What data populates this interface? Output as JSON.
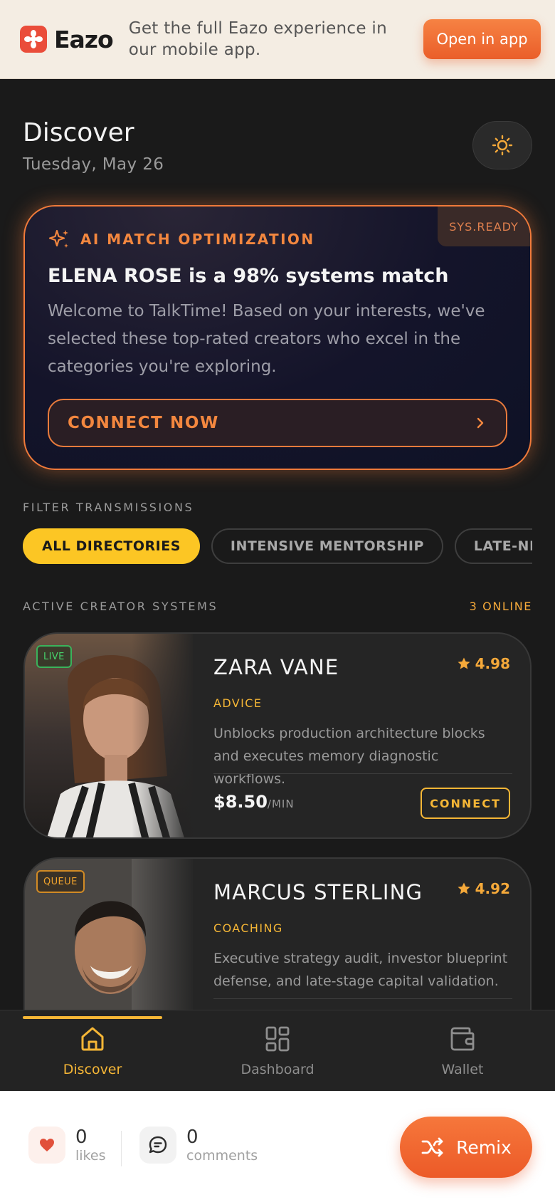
{
  "banner": {
    "brand": "Eazo",
    "text": "Get the full Eazo experience in our mobile app.",
    "open_label": "Open in app"
  },
  "header": {
    "title": "Discover",
    "date": "Tuesday, May 26"
  },
  "ai_card": {
    "badge": "SYS.READY",
    "kicker": "AI MATCH OPTIMIZATION",
    "title": "ELENA ROSE is a 98% systems match",
    "body": "Welcome to TalkTime! Based on your interests, we've selected these top-rated creators who excel in the categories you're exploring.",
    "cta": "CONNECT NOW"
  },
  "filters": {
    "label": "FILTER TRANSMISSIONS",
    "chips": [
      "ALL DIRECTORIES",
      "INTENSIVE MENTORSHIP",
      "LATE-NIGHT"
    ]
  },
  "creators_section": {
    "label": "ACTIVE CREATOR SYSTEMS",
    "online": "3 ONLINE"
  },
  "creators": [
    {
      "status": "LIVE",
      "name": "ZARA VANE",
      "rating": "4.98",
      "category": "ADVICE",
      "description": "Unblocks production architecture blocks and executes memory diagnostic workflows.",
      "price": "$8.50",
      "unit": "/MIN",
      "cta": "CONNECT"
    },
    {
      "status": "QUEUE",
      "name": "MARCUS STERLING",
      "rating": "4.92",
      "category": "COACHING",
      "description": "Executive strategy audit, investor blueprint defense, and late-stage capital validation."
    }
  ],
  "nav": {
    "items": [
      {
        "label": "Discover",
        "icon": "home-icon"
      },
      {
        "label": "Dashboard",
        "icon": "grid-icon"
      },
      {
        "label": "Wallet",
        "icon": "wallet-icon"
      }
    ],
    "active": "Discover"
  },
  "footer": {
    "likes_count": "0",
    "likes_label": "likes",
    "comments_count": "0",
    "comments_label": "comments",
    "remix_label": "Remix"
  },
  "colors": {
    "accent_orange": "#f07a3a",
    "accent_yellow": "#fcc624",
    "live_green": "#47d36b",
    "background": "#1a1a1a"
  }
}
